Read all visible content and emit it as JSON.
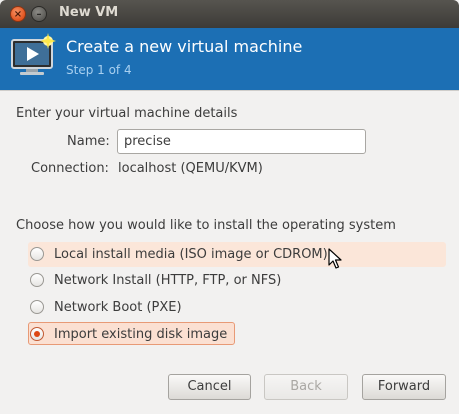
{
  "window": {
    "title": "New VM",
    "close_glyph": "×",
    "minimize_glyph": "–"
  },
  "header": {
    "title": "Create a new virtual machine",
    "step": "Step 1 of 4",
    "icon": "monitor-play-icon"
  },
  "details": {
    "heading": "Enter your virtual machine details",
    "name_label": "Name:",
    "name_value": "precise",
    "connection_label": "Connection:",
    "connection_value": "localhost (QEMU/KVM)"
  },
  "install": {
    "heading": "Choose how you would like to install the operating system",
    "options": [
      {
        "label": "Local install media (ISO image or CDROM)",
        "selected": false
      },
      {
        "label": "Network Install (HTTP, FTP, or NFS)",
        "selected": false
      },
      {
        "label": "Network Boot (PXE)",
        "selected": false
      },
      {
        "label": "Import existing disk image",
        "selected": true
      }
    ]
  },
  "buttons": {
    "cancel": "Cancel",
    "back": "Back",
    "forward": "Forward"
  },
  "colors": {
    "header_bg": "#1c6fb4",
    "accent": "#dd4814"
  }
}
